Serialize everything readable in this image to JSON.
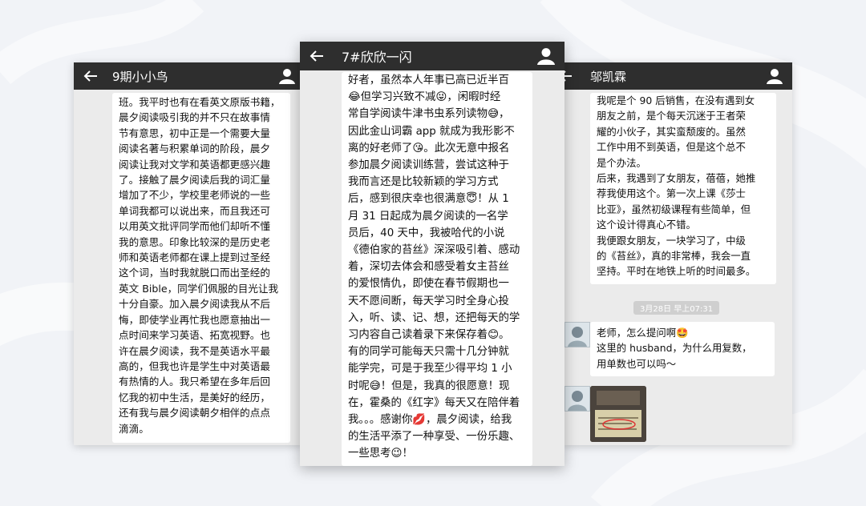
{
  "colors": {
    "page_bg": "#f1f3f7",
    "titlebar": "#2e2e2e",
    "chat_bg": "#ebebeb",
    "bubble": "#ffffff"
  },
  "left_chat": {
    "title": "9期小小鸟",
    "message": "班。我平时也有在看英文原版书籍，\n晨夕阅读吸引我的并不只在故事情\n节有意思，初中正是一个需要大量\n阅读名著与积累单词的阶段，晨夕\n阅读让我对文学和英语都更感兴趣\n了。接触了晨夕阅读后我的词汇量\n增加了不少，学校里老师说的一些\n单词我都可以说出来，而且我还可\n以用英文批评同学而他们却听不懂\n我的意思。印象比较深的是历史老\n师和英语老师都在课上提到过圣经\n这个词，当时我就脱口而出圣经的\n英文 Bible，同学们佩服的目光让我\n十分自豪。加入晨夕阅读我从不后\n悔，即使学业再忙我也愿意抽出一\n点时间来学习英语、拓宽视野。也\n许在晨夕阅读，我不是英语水平最\n高的，但我也许是学生中对英语最\n有热情的人。我只希望在多年后回\n忆我的初中生活，是美好的经历，\n还有我与晨夕阅读朝夕相伴的点点\n滴滴。"
  },
  "center_chat": {
    "title": "7#欣欣一闪",
    "message": "好者，虽然本人年事已高已近半百\n😂但学习兴致不减😜，闲暇时经\n常自学阅读牛津书虫系列读物😅，\n因此金山词霸 app 就成为我形影不\n离的好老师了😘。此次无意中报名\n参加晨夕阅读训练营，尝试这种于\n我而言还是比较新颖的学习方式\n后，感到很庆幸也很满意😇！从 1\n月 31 日起成为晨夕阅读的一名学\n员后，40 天中，我被哈代的小说\n《德伯家的苔丝》深深吸引着、感动\n着，深切去体会和感受着女主苔丝\n的爱恨情仇，即使在春节假期也一\n天不愿间断，每天学习时全身心投\n入，听、读、记、想，还把每天的学\n习内容自己读着录下来保存着😊。\n有的同学可能每天只需十几分钟就\n能学完，可是于我至少得平均 1 小\n时呢😅！但是，我真的很愿意！现\n在，霍桑的《红字》每天又在陪伴着\n我。。。感谢你💋，晨夕阅读，给我\n的生活平添了一种享受、一份乐趣、\n一些思考😉！"
  },
  "right_chat": {
    "title": "邬凯霖",
    "message": "我呢是个 90 后销售，在没有遇到女\n朋友之前，是个每天沉迷于王者荣\n耀的小伙子，其实蛮颓废的。虽然\n工作中用不到英语，但是这个总不\n是个办法。\n后来，我遇到了女朋友，蓓蓓，她推\n荐我使用这个。第一次上课《莎士\n比亚》，虽然初级课程有些简单，但\n这个设计得真心不错。\n我便跟女朋友，一块学习了，中级\n的《苔丝》，真的非常棒，我会一直\n坚持。平时在地铁上听的时间最多。",
    "timestamp": "3月28日 早上07:31",
    "question": "老师，怎么提问啊🤩\n这里的 husband，为什么用复数，\n用单数也可以吗～"
  }
}
